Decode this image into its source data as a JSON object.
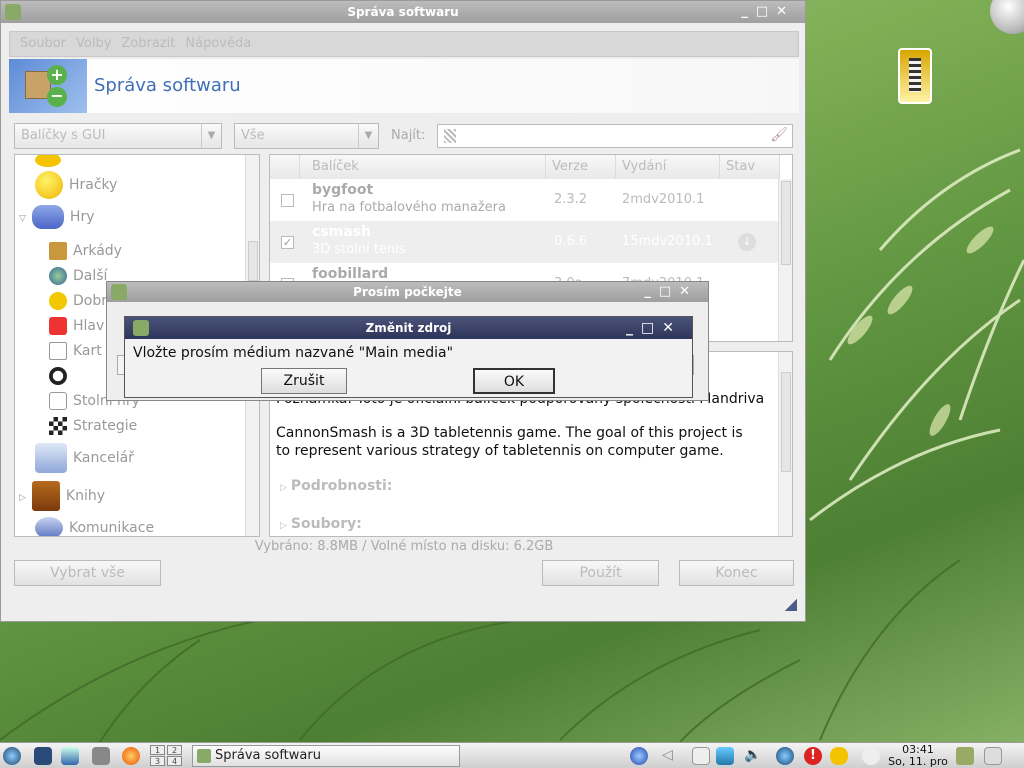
{
  "main_window": {
    "title": "Správa softwaru",
    "menu": [
      "Soubor",
      "Volby",
      "Zobrazit",
      "Nápověda"
    ],
    "banner_title": "Správa softwaru",
    "filter_combo": "Balíčky s GUI",
    "scope_combo": "Vše",
    "search_label": "Najít:",
    "tree_items": [
      "Hračky",
      "Hry",
      "Arkády",
      "Další",
      "Dobr",
      "Hlav",
      "Kart",
      "",
      "Stolní hry",
      "Strategie",
      "Kancelář",
      "Knihy",
      "Komunikace"
    ],
    "columns": [
      "Balíček",
      "Verze",
      "Vydání",
      "Stav"
    ],
    "packages": [
      {
        "name": "bygfoot",
        "desc": "Hra na fotbalového manažera",
        "version": "2.3.2",
        "release": "2mdv2010.1",
        "checked": false
      },
      {
        "name": "csmash",
        "desc": "3D stolní tenis",
        "version": "0.6.6",
        "release": "15mdv2010.1",
        "checked": true
      },
      {
        "name": "foobillard",
        "desc": "",
        "version": "3.0a",
        "release": "7mdv2010.1",
        "checked": false
      }
    ],
    "description_line1": "Poznámka: Toto je oficiální balíček podporovaný společností Mandriva",
    "description_body": "CannonSmash is a 3D tabletennis game. The goal of this project is to represent various strategy of tabletennis on computer game.",
    "section_details": "Podrobnosti:",
    "section_files": "Soubory:",
    "status": "Vybráno: 8.8MB / Volné místo na disku: 6.2GB",
    "btn_select_all": "Vybrat vše",
    "btn_apply": "Použít",
    "btn_quit": "Konec"
  },
  "wait_dialog": {
    "title": "Prosím počkejte"
  },
  "source_dialog": {
    "title": "Změnit zdroj",
    "message": "Vložte prosím médium nazvané \"Main media\"",
    "cancel": "Zrušit",
    "ok": "OK"
  },
  "taskbar": {
    "pager": [
      "1",
      "2",
      "3",
      "4"
    ],
    "task": "Správa softwaru",
    "time": "03:41",
    "date": "So, 11. pro"
  }
}
